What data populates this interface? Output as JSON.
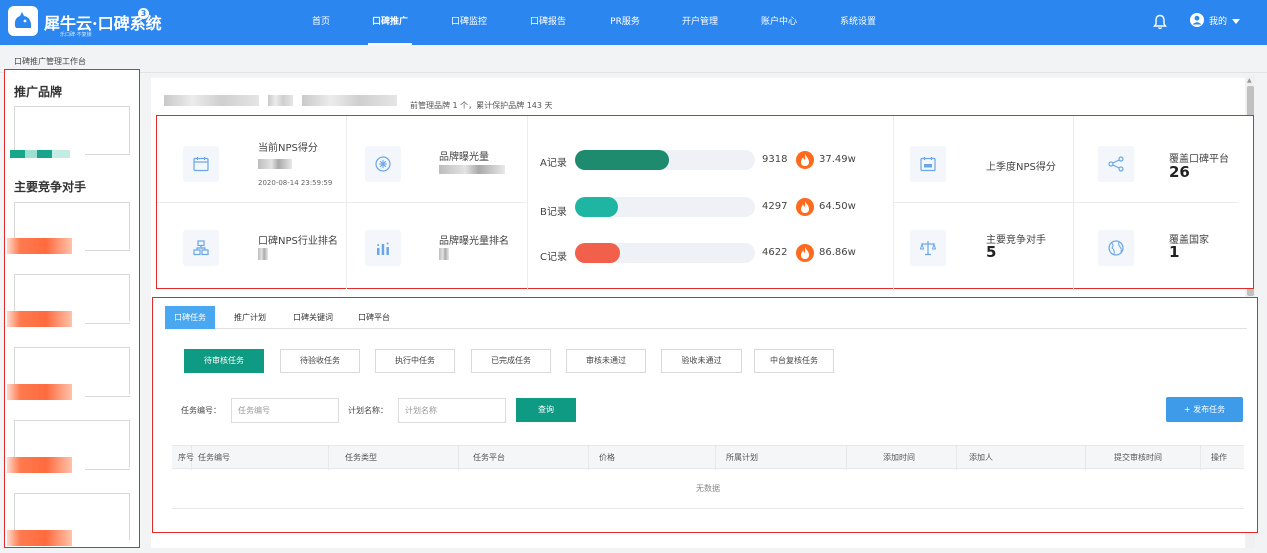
{
  "header": {
    "brand_title": "犀牛云·口碑系统",
    "brand_badge": "3",
    "brand_slogan": "乐口碑·不复锁",
    "nav": [
      {
        "label": "首页"
      },
      {
        "label": "口碑推广"
      },
      {
        "label": "口碑监控"
      },
      {
        "label": "口碑报告"
      },
      {
        "label": "PR服务"
      },
      {
        "label": "开户管理"
      },
      {
        "label": "账户中心"
      },
      {
        "label": "系统设置"
      }
    ],
    "active_nav": "口碑推广",
    "user_label": "我的",
    "icons": [
      "bell-icon",
      "user-avatar-icon",
      "caret-down-icon"
    ]
  },
  "breadcrumb": "口碑推广管理工作台",
  "sidebar": {
    "promoted_brand_title": "推广品牌",
    "competitors_title": "主要竞争对手"
  },
  "summary": {
    "text": "前管理品牌 1 个，累计保护品牌 143 天"
  },
  "stats": {
    "nps": {
      "label": "当前NPS得分",
      "date": "2020-08-14 23:59:59"
    },
    "exposure": {
      "label": "品牌曝光量"
    },
    "nps_rank": {
      "label": "口碑NPS行业排名"
    },
    "exposure_rank": {
      "label": "品牌曝光量排名"
    },
    "last_quarter_nps": {
      "label": "上季度NPS得分"
    },
    "competitors": {
      "label": "主要竞争对手",
      "value": "5"
    },
    "platforms": {
      "label": "覆盖口碑平台",
      "value": "26"
    },
    "countries": {
      "label": "覆盖国家",
      "value": "1"
    },
    "records": [
      {
        "label": "A记录",
        "count": "9318",
        "amount": "37.49w",
        "fill": 0.52,
        "color": "#1e8a6e"
      },
      {
        "label": "B记录",
        "count": "4297",
        "amount": "64.50w",
        "fill": 0.24,
        "color": "#1fb5a3"
      },
      {
        "label": "C记录",
        "count": "4622",
        "amount": "86.86w",
        "fill": 0.25,
        "color": "#f0604a"
      }
    ]
  },
  "tasks": {
    "tabs": [
      {
        "label": "口碑任务"
      },
      {
        "label": "推广计划"
      },
      {
        "label": "口碑关键词"
      },
      {
        "label": "口碑平台"
      }
    ],
    "status_buttons": [
      {
        "label": "待审核任务"
      },
      {
        "label": "待验收任务"
      },
      {
        "label": "执行中任务"
      },
      {
        "label": "已完成任务"
      },
      {
        "label": "审核未通过"
      },
      {
        "label": "验收未通过"
      },
      {
        "label": "中台复核任务"
      }
    ],
    "filter": {
      "task_no_label": "任务编号：",
      "task_no_placeholder": "任务编号",
      "plan_name_label": "计划名称：",
      "plan_name_placeholder": "计划名称",
      "query_button": "查询"
    },
    "publish_button": "+ 发布任务",
    "columns": [
      "序号",
      "任务编号",
      "任务类型",
      "任务平台",
      "价格",
      "所属计划",
      "添加时间",
      "添加人",
      "提交审核时间",
      "操作"
    ],
    "empty_text": "无数据"
  }
}
